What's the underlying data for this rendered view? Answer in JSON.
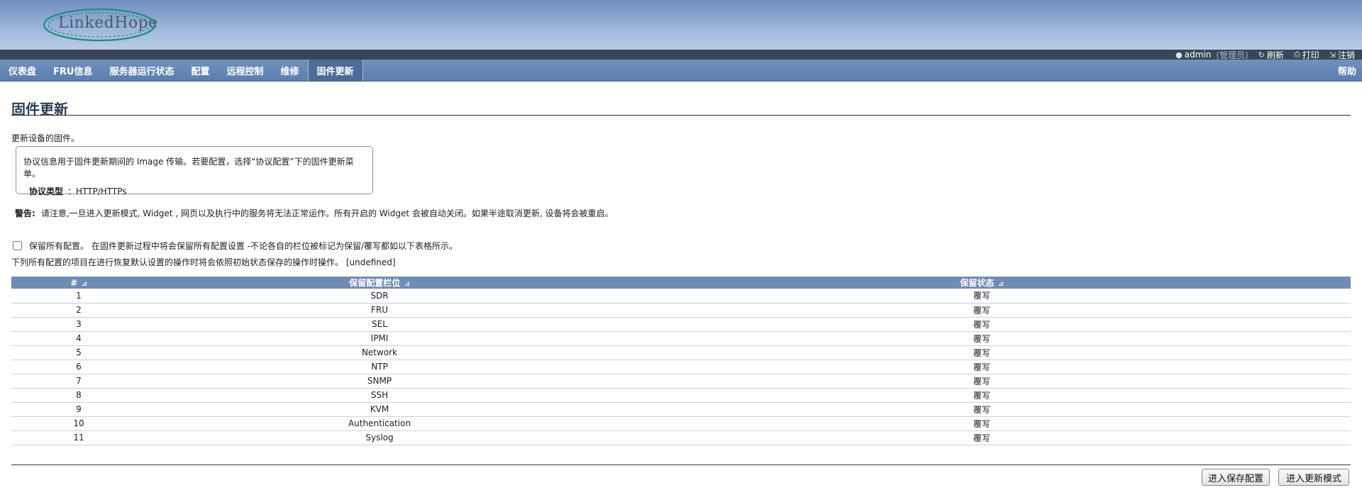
{
  "header": {
    "logo_text": "LinkedHope",
    "user": "admin",
    "role": "(管理员)",
    "refresh": "刷新",
    "print": "打印",
    "logout": "注销"
  },
  "nav": {
    "tabs": [
      "仪表盘",
      "FRU信息",
      "服务器运行状态",
      "配置",
      "远程控制",
      "维修",
      "固件更新"
    ],
    "active_index": 6,
    "help": "帮助"
  },
  "main": {
    "title": "固件更新",
    "description": "更新设备的固件。",
    "info_line": "协议信息用于固件更新期间的 Image 传输。若要配置，选择“协议配置”下的固件更新菜单。",
    "protocol_label": "协议类型",
    "protocol_value": "：HTTP/HTTPs",
    "warning_label": "警告:",
    "warning_text": "请注意,一旦进入更新模式, Widget , 网页以及执行中的服务将无法正常运作。所有开启的 Widget 会被自动关闭。如果半途取消更新, 设备将会被重启。",
    "preserve_all": "保留所有配置。  在固件更新过程中将会保留所有配置设置 -不论各自的栏位被标记为保留/覆写都如以下表格所示。",
    "note": "下列所有配置的项目在进行恢复默认设置的操作时将会依照初始状态保存的操作时操作。 [undefined]"
  },
  "table": {
    "columns": [
      "#",
      "保留配置栏位",
      "保留状态"
    ],
    "rows": [
      {
        "num": "1",
        "field": "SDR",
        "status": "覆写"
      },
      {
        "num": "2",
        "field": "FRU",
        "status": "覆写"
      },
      {
        "num": "3",
        "field": "SEL",
        "status": "覆写"
      },
      {
        "num": "4",
        "field": "IPMI",
        "status": "覆写"
      },
      {
        "num": "5",
        "field": "Network",
        "status": "覆写"
      },
      {
        "num": "6",
        "field": "NTP",
        "status": "覆写"
      },
      {
        "num": "7",
        "field": "SNMP",
        "status": "覆写"
      },
      {
        "num": "8",
        "field": "SSH",
        "status": "覆写"
      },
      {
        "num": "9",
        "field": "KVM",
        "status": "覆写"
      },
      {
        "num": "10",
        "field": "Authentication",
        "status": "覆写"
      },
      {
        "num": "11",
        "field": "Syslog",
        "status": "覆写"
      }
    ]
  },
  "buttons": {
    "save_config": "进入保存配置",
    "update_mode": "进入更新模式"
  },
  "colors": {
    "nav_bg": "#6584b3",
    "table_header": "#6f8cb5",
    "title": "#2d3e56"
  }
}
